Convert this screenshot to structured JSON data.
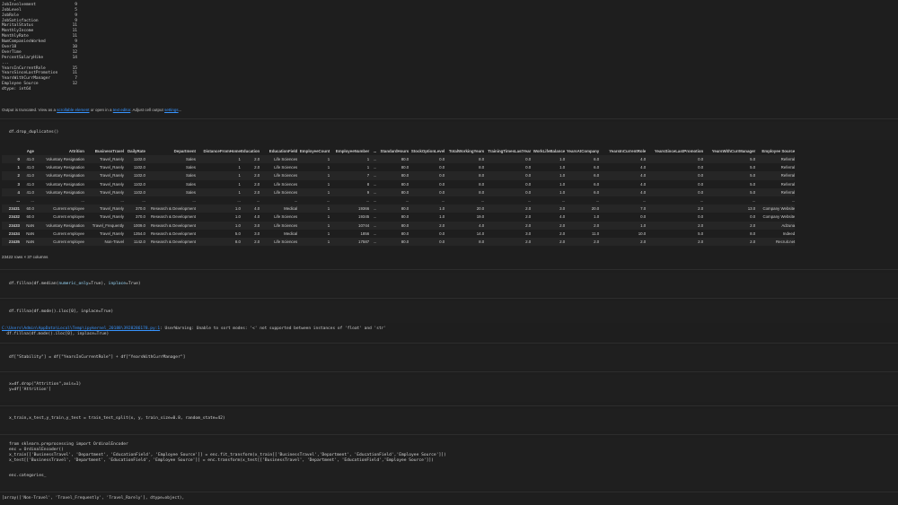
{
  "output_series": [
    {
      "key": "HourlyRate",
      "val": "9"
    },
    {
      "key": "JobInvolvement",
      "val": "9"
    },
    {
      "key": "JobLevel",
      "val": "5"
    },
    {
      "key": "JobRole",
      "val": "9"
    },
    {
      "key": "JobSatisfaction",
      "val": "9"
    },
    {
      "key": "MaritalStatus",
      "val": "11"
    },
    {
      "key": "MonthlyIncome",
      "val": "11"
    },
    {
      "key": "MonthlyRate",
      "val": "11"
    },
    {
      "key": "NumCompaniesWorked",
      "val": "9"
    },
    {
      "key": "Over18",
      "val": "10"
    },
    {
      "key": "OverTime",
      "val": "12"
    },
    {
      "key": "PercentSalaryHike",
      "val": "14"
    },
    {
      "key": "...",
      "val": ""
    },
    {
      "key": "YearsInCurrentRole",
      "val": "15"
    },
    {
      "key": "YearsSinceLastPromotion",
      "val": "11"
    },
    {
      "key": "YearsWithCurrManager",
      "val": "7"
    },
    {
      "key": "Employee Source",
      "val": "12"
    },
    {
      "key": "dtype: int64",
      "val": ""
    }
  ],
  "truncated_notice": {
    "prefix": "Output is truncated. View as a ",
    "link1": "scrollable element",
    "middle": " or open in a ",
    "link2": "text editor",
    "middle2": ". Adjust cell output ",
    "link3": "settings",
    "suffix": "..."
  },
  "cells": {
    "c1": "df.drop_duplicates()",
    "c2_a": "df.fillna(df.median(",
    "c2_b": "numeric_only",
    "c2_c": "=True), ",
    "c2_d": "inplace",
    "c2_e": "=True)",
    "c3": "df.fillna(df.mode().iloc[0], inplace=True)",
    "c4": "df[\"Stability\"] = df[\"YearsInCurrentRole\"] + df[\"YearsWithCurrManager\"]",
    "c5_1": "x=df.drop(\"Attrition\",axis=1)",
    "c5_2": "y=df['Attrition']",
    "c6": "x_train,x_test,y_train,y_test = train_test_split(x, y, train_size=0.8, random_state=42)",
    "c7_1": "from sklearn.preprocessing import OrdinalEncoder",
    "c7_2": "enc = OrdinalEncoder()",
    "c7_3": "x_train[['BusinessTravel', 'Department', 'EducationField', 'Employee Source']] = enc.fit_transform(x_train[['BusinessTravel','Department', 'EducationField','Employee Source']])",
    "c7_4": "x_test[['BusinessTravel', 'Department', 'EducationField', 'Employee Source']] = enc.transform(x_test[['BusinessTravel', 'Department', 'EducationField','Employee Source']])",
    "c7_5": "enc.categories_"
  },
  "warning": {
    "path": "C:\\Users\\Admin\\AppData\\Local\\Temp\\ipykernel_20188\\3928286178.py:1",
    "msg": ": UserWarning: Unable to sort modes: '<' not supported between instances of 'float' and 'str'",
    "line2": "  df.fillna(df.mode().iloc[0], inplace=True)"
  },
  "final_output": "[array(['Non-Travel', 'Travel_Frequently', 'Travel_Rarely'], dtype=object),",
  "dataframe": {
    "columns": [
      "",
      "Age",
      "Attrition",
      "BusinessTravel",
      "DailyRate",
      "Department",
      "DistanceFromHome",
      "Education",
      "EducationField",
      "EmployeeCount",
      "EmployeeNumber",
      "...",
      "StandardHours",
      "StockOptionLevel",
      "TotalWorkingYears",
      "TrainingTimesLastYear",
      "WorkLifeBalance",
      "YearsAtCompany",
      "YearsInCurrentRole",
      "YearsSinceLastPromotion",
      "YearsWithCurrManager",
      "Employee Source"
    ],
    "rows": [
      [
        "0",
        "41.0",
        "Voluntary Resignation",
        "Travel_Rarely",
        "1102.0",
        "Sales",
        "1",
        "2.0",
        "Life Sciences",
        "1",
        "1",
        "...",
        "80.0",
        "0.0",
        "8.0",
        "0.0",
        "1.0",
        "6.0",
        "4.0",
        "0.0",
        "5.0",
        "Referral"
      ],
      [
        "1",
        "41.0",
        "Voluntary Resignation",
        "Travel_Rarely",
        "1102.0",
        "Sales",
        "1",
        "2.0",
        "Life Sciences",
        "1",
        "1",
        "...",
        "80.0",
        "0.0",
        "8.0",
        "0.0",
        "1.0",
        "6.0",
        "4.0",
        "0.0",
        "5.0",
        "Referral"
      ],
      [
        "2",
        "41.0",
        "Voluntary Resignation",
        "Travel_Rarely",
        "1102.0",
        "Sales",
        "1",
        "2.0",
        "Life Sciences",
        "1",
        "7",
        "...",
        "80.0",
        "0.0",
        "8.0",
        "0.0",
        "1.0",
        "6.0",
        "4.0",
        "0.0",
        "5.0",
        "Referral"
      ],
      [
        "3",
        "41.0",
        "Voluntary Resignation",
        "Travel_Rarely",
        "1102.0",
        "Sales",
        "1",
        "2.0",
        "Life Sciences",
        "1",
        "8",
        "...",
        "80.0",
        "0.0",
        "8.0",
        "0.0",
        "1.0",
        "6.0",
        "4.0",
        "0.0",
        "5.0",
        "Referral"
      ],
      [
        "4",
        "41.0",
        "Voluntary Resignation",
        "Travel_Rarely",
        "1102.0",
        "Sales",
        "1",
        "2.0",
        "Life Sciences",
        "1",
        "9",
        "...",
        "80.0",
        "0.0",
        "8.0",
        "0.0",
        "1.0",
        "6.0",
        "4.0",
        "0.0",
        "5.0",
        "Referral"
      ],
      [
        "...",
        "...",
        "...",
        "...",
        "...",
        "...",
        "...",
        "...",
        "...",
        "...",
        "...",
        "...",
        "...",
        "...",
        "...",
        "...",
        "...",
        "...",
        "...",
        "...",
        "...",
        "..."
      ],
      [
        "23431",
        "60.0",
        "Current employee",
        "Travel_Rarely",
        "370.0",
        "Research & Development",
        "1.0",
        "4.0",
        "Medical",
        "1",
        "19366",
        "...",
        "80.0",
        "1.0",
        "20.0",
        "2.0",
        "3.0",
        "20.0",
        "7.0",
        "2.0",
        "13.0",
        "Company Website"
      ],
      [
        "23432",
        "60.0",
        "Current employee",
        "Travel_Rarely",
        "370.0",
        "Research & Development",
        "1.0",
        "4.0",
        "Life Sciences",
        "1",
        "19345",
        "...",
        "80.0",
        "1.0",
        "19.0",
        "2.0",
        "4.0",
        "1.0",
        "0.0",
        "0.0",
        "0.0",
        "Company Website"
      ],
      [
        "23433",
        "NaN",
        "Voluntary Resignation",
        "Travel_Frequently",
        "1009.0",
        "Research & Development",
        "1.0",
        "3.0",
        "Life Sciences",
        "1",
        "10744",
        "...",
        "80.0",
        "2.0",
        "4.0",
        "2.0",
        "2.0",
        "2.0",
        "1.0",
        "2.0",
        "2.0",
        "Adzuna"
      ],
      [
        "23434",
        "NaN",
        "Current employee",
        "Travel_Rarely",
        "1354.0",
        "Research & Development",
        "5.0",
        "3.0",
        "Medical",
        "1",
        "1856",
        "...",
        "80.0",
        "0.0",
        "14.0",
        "3.0",
        "2.0",
        "11.0",
        "10.0",
        "5.0",
        "8.0",
        "Indeed"
      ],
      [
        "23435",
        "NaN",
        "Current employee",
        "Non-Travel",
        "1142.0",
        "Research & Development",
        "8.0",
        "2.0",
        "Life Sciences",
        "1",
        "17587",
        "...",
        "80.0",
        "0.0",
        "8.0",
        "2.0",
        "2.0",
        "2.0",
        "2.0",
        "2.0",
        "2.0",
        "Recruit.net"
      ]
    ],
    "shape": "23422 rows × 37 columns"
  }
}
